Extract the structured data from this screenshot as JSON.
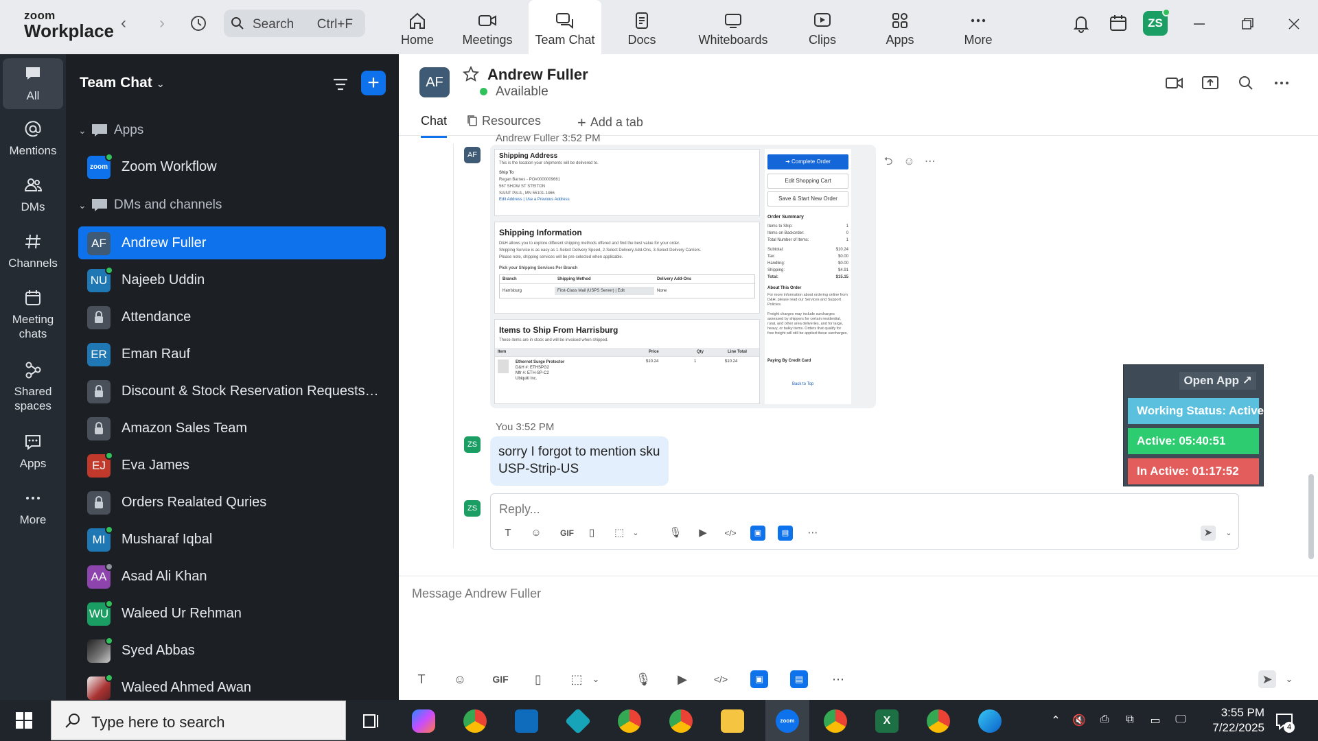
{
  "brand": {
    "line1": "zoom",
    "line2": "Workplace"
  },
  "search": {
    "label": "Search",
    "shortcut": "Ctrl+F"
  },
  "top_tabs": [
    {
      "label": "Home"
    },
    {
      "label": "Meetings"
    },
    {
      "label": "Team Chat"
    },
    {
      "label": "Docs"
    },
    {
      "label": "Whiteboards"
    },
    {
      "label": "Clips"
    },
    {
      "label": "Apps"
    },
    {
      "label": "More"
    }
  ],
  "user": {
    "initials": "ZS"
  },
  "rail": [
    {
      "label": "All"
    },
    {
      "label": "Mentions"
    },
    {
      "label": "DMs"
    },
    {
      "label": "Channels"
    },
    {
      "label": "Meeting chats"
    },
    {
      "label": "Shared spaces"
    },
    {
      "label": "Apps"
    },
    {
      "label": "More"
    }
  ],
  "sidebar": {
    "title": "Team Chat",
    "sections": {
      "apps": "Apps",
      "dms": "DMs and channels"
    },
    "app_item": {
      "name": "Zoom Workflow",
      "icon_text": "zoom"
    },
    "items": [
      {
        "initials": "AF",
        "name": "Andrew Fuller",
        "color": "#3f5a75"
      },
      {
        "initials": "NU",
        "name": "Najeeb Uddin",
        "color": "#1f78b4"
      },
      {
        "initials": "",
        "name": "Attendance",
        "color": "#4a5059"
      },
      {
        "initials": "ER",
        "name": "Eman Rauf",
        "color": "#1f78b4"
      },
      {
        "initials": "",
        "name": "Discount & Stock Reservation Requests O...",
        "color": "#4a5059"
      },
      {
        "initials": "",
        "name": "Amazon Sales Team",
        "color": "#4a5059"
      },
      {
        "initials": "EJ",
        "name": "Eva James",
        "color": "#c0392b"
      },
      {
        "initials": "",
        "name": "Orders Realated Quries",
        "color": "#4a5059"
      },
      {
        "initials": "MI",
        "name": "Musharaf Iqbal",
        "color": "#1f78b4"
      },
      {
        "initials": "AA",
        "name": "Asad Ali Khan",
        "color": "#8e44ad"
      },
      {
        "initials": "WU",
        "name": "Waleed Ur Rehman",
        "color": "#1b9e64"
      },
      {
        "initials": "",
        "name": "Syed Abbas",
        "color": "#555555"
      },
      {
        "initials": "",
        "name": "Waleed Ahmed Awan",
        "color": "#7a3b3b"
      }
    ]
  },
  "chat": {
    "contact_initials": "AF",
    "contact_name": "Andrew Fuller",
    "status": "Available",
    "tabs": {
      "chat": "Chat",
      "resources": "Resources",
      "add": "Add a tab"
    },
    "msg1_sender": "Andrew Fuller",
    "msg1_time": "3:52 PM",
    "you_label": "You",
    "msg2_time": "3:52 PM",
    "msg2_text": "sorry I forgot to mention sku USP-Strip-US",
    "reply_placeholder": "Reply...",
    "compose_placeholder": "Message Andrew Fuller",
    "toolbar_gif": "GIF"
  },
  "screenshot": {
    "ship_address_title": "Shipping Address",
    "ship_address_sub": "This is the location your shipments will be delivered to.",
    "ship_to": "Ship To",
    "addr1": "Regan Barnes - PO#0000009661",
    "addr2": "567 SHOW ST STEITON",
    "addr3": "SAINT PAUL, MN 55101-1466",
    "addr_link": "Edit Address | Use a Previous Address",
    "ship_info_title": "Shipping Information",
    "ship_info_text1": "D&H allows you to explore different shipping methods offered and find the best value for your order.",
    "ship_info_text2": "Shipping Service is as easy as 1-Select Delivery Speed, 2-Select Delivery Add-Ons, 3-Select Delivery Carriers.",
    "ship_info_text3": "Please note, shipping services will be pre-selected when applicable.",
    "pick_services": "Pick your Shipping Services Per Branch",
    "col_branch": "Branch",
    "col_method": "Shipping Method",
    "col_addons": "Delivery Add-Ons",
    "branch": "Harrisburg",
    "method": "First-Class Mail (USPS Server) | Edit",
    "addon": "None",
    "items_title": "Items to Ship From Harrisburg",
    "items_sub": "These items are in stock and will be invoiced when shipped.",
    "col_item": "Item",
    "col_price": "Price",
    "col_qty": "Qty",
    "col_total": "Line Total",
    "item_name": "Ethernet Surge Protector",
    "item_d1": "D&H #: ETHSPG2",
    "item_d2": "Mfr #: ETH-SP-C2",
    "item_d3": "Ubiquiti Inc.",
    "item_price": "$10.24",
    "item_qty": "1",
    "item_total": "$10.24",
    "btn_complete": "➔ Complete Order",
    "btn_edit_cart": "Edit Shopping Cart",
    "btn_save": "Save & Start New Order",
    "order_summary": "Order Summary",
    "sum": [
      {
        "k": "Items to Ship:",
        "v": "1"
      },
      {
        "k": "Items on Backorder:",
        "v": "0"
      },
      {
        "k": "Total Number of Items:",
        "v": "1"
      },
      {
        "k": "Subtotal:",
        "v": "$10.24"
      },
      {
        "k": "Tax:",
        "v": "$0.00"
      },
      {
        "k": "Handling:",
        "v": "$0.00"
      },
      {
        "k": "Shipping:",
        "v": "$4.91"
      },
      {
        "k": "Total:",
        "v": "$15.15"
      }
    ],
    "about_title": "About This Order",
    "about_text": "For more information about ordering online from D&H, please read our Services and Support Policies.",
    "freight_text": "Freight charges may include surcharges assessed by shippers for certain residential, rural, and other area deliveries, and for large, heavy, or bulky items. Orders that qualify for free freight will still be applied these surcharges.",
    "paying": "Paying By Credit Card",
    "back_top": "Back to Top"
  },
  "widget": {
    "open_app": "Open App ↗",
    "working": "Working Status: Active",
    "active": "Active: 05:40:51",
    "inactive": "In Active: 01:17:52",
    "colors": {
      "working": "#5bc0de",
      "active": "#2ecc71",
      "inactive": "#e35d5d"
    }
  },
  "taskbar": {
    "search": "Type here to search",
    "time": "3:55 PM",
    "date": "7/22/2025",
    "notifications": "4"
  }
}
